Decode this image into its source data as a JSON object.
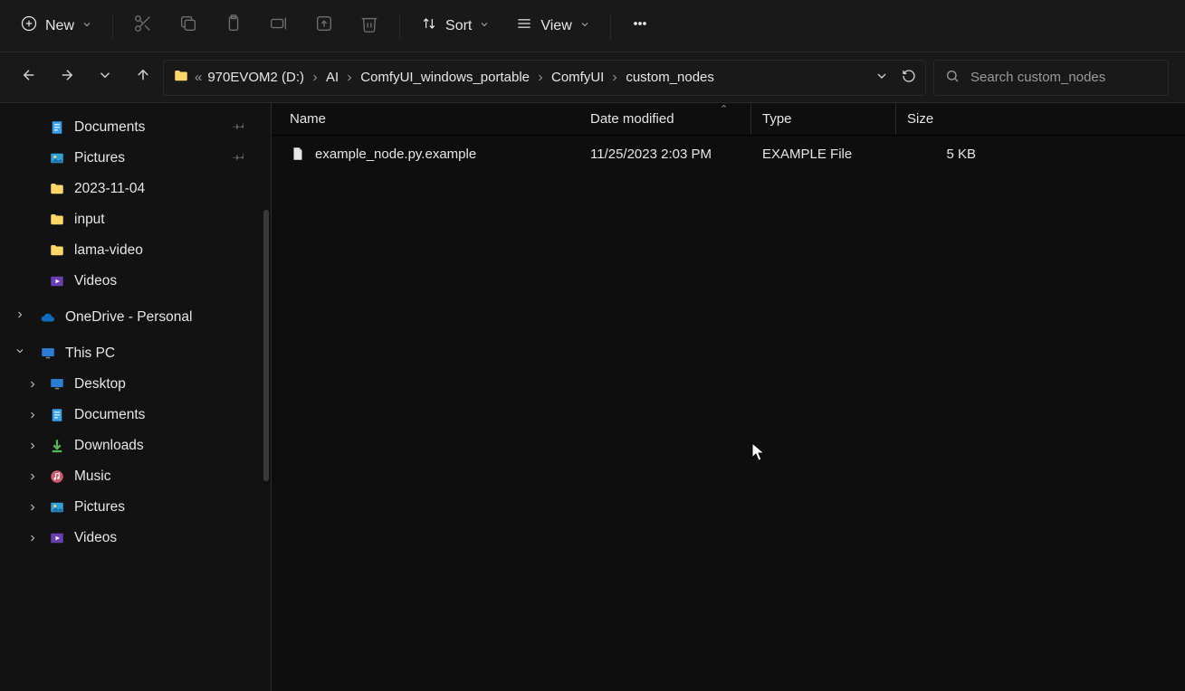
{
  "toolbar": {
    "new_label": "New",
    "sort_label": "Sort",
    "view_label": "View"
  },
  "breadcrumb": {
    "drive": "970EVOM2 (D:)",
    "segments": [
      "AI",
      "ComfyUI_windows_portable",
      "ComfyUI",
      "custom_nodes"
    ]
  },
  "search": {
    "placeholder": "Search custom_nodes"
  },
  "columns": {
    "name": "Name",
    "date": "Date modified",
    "type": "Type",
    "size": "Size"
  },
  "files": [
    {
      "name": "example_node.py.example",
      "date": "11/25/2023 2:03 PM",
      "type": "EXAMPLE File",
      "size": "5 KB"
    }
  ],
  "sidebar": {
    "quick": [
      {
        "label": "Documents",
        "icon": "doc",
        "pinned": true
      },
      {
        "label": "Pictures",
        "icon": "picture",
        "pinned": true
      },
      {
        "label": "2023-11-04",
        "icon": "folder",
        "pinned": false
      },
      {
        "label": "input",
        "icon": "folder",
        "pinned": false
      },
      {
        "label": "lama-video",
        "icon": "folder",
        "pinned": false
      },
      {
        "label": "Videos",
        "icon": "video",
        "pinned": false
      }
    ],
    "onedrive_label": "OneDrive - Personal",
    "thispc_label": "This PC",
    "thispc": [
      {
        "label": "Desktop",
        "icon": "desktop"
      },
      {
        "label": "Documents",
        "icon": "doc"
      },
      {
        "label": "Downloads",
        "icon": "download"
      },
      {
        "label": "Music",
        "icon": "music"
      },
      {
        "label": "Pictures",
        "icon": "picture"
      },
      {
        "label": "Videos",
        "icon": "video"
      }
    ]
  }
}
